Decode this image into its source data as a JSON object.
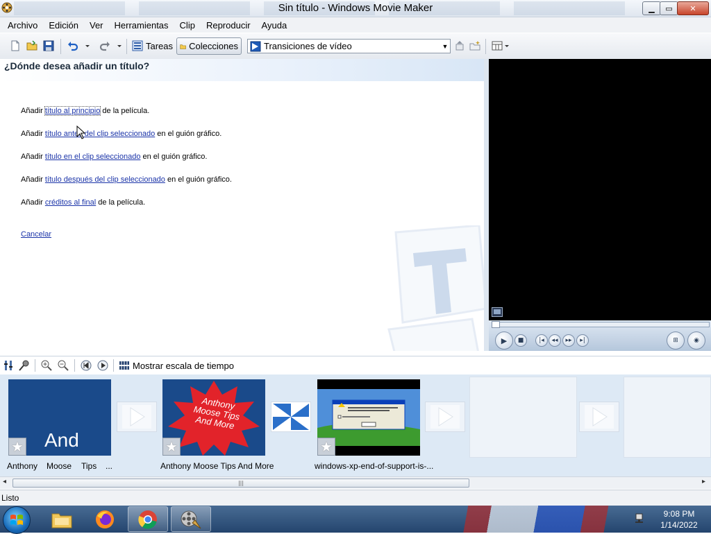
{
  "window": {
    "title": "Sin título - Windows Movie Maker",
    "min_glyph": "▁",
    "max_glyph": "▭",
    "close_glyph": "✕"
  },
  "menu": [
    "Archivo",
    "Edición",
    "Ver",
    "Herramientas",
    "Clip",
    "Reproducir",
    "Ayuda"
  ],
  "toolbar": {
    "tasks_label": "Tareas",
    "collections_label": "Colecciones",
    "collection_select_value": "Transiciones de vídeo",
    "icons": [
      "new-project-icon",
      "open-project-icon",
      "save-project-icon",
      "undo-icon",
      "redo-icon",
      "tasks-icon",
      "collections-folder-icon",
      "collection-up-icon",
      "new-collection-icon",
      "views-icon"
    ]
  },
  "task_pane": {
    "heading": "¿Dónde desea añadir un título?",
    "options": [
      {
        "pre": "Añadir ",
        "link": "título al principio",
        "post": " de la película."
      },
      {
        "pre": "Añadir ",
        "link": "título antes del clip seleccionado",
        "post": " en el guión gráfico."
      },
      {
        "pre": "Añadir ",
        "link": "título en el clip seleccionado",
        "post": " en el guión gráfico."
      },
      {
        "pre": "Añadir ",
        "link": "título después del clip seleccionado",
        "post": " en el guión gráfico."
      },
      {
        "pre": "Añadir ",
        "link": "créditos al final",
        "post": " de la película."
      }
    ],
    "cancel": "Cancelar"
  },
  "storyboard": {
    "show_timeline_label": "Mostrar escala de tiempo",
    "clips": [
      {
        "label_parts": [
          "Anthony",
          "Moose",
          "Tips",
          "..."
        ],
        "thumb_text": "And"
      },
      {
        "label": "Anthony Moose Tips And More",
        "thumb_text": "Anthony Moose Tips And More"
      },
      {
        "label": "windows-xp-end-of-support-is-..."
      }
    ],
    "star_glyph": "★"
  },
  "scrollbar": {
    "left_arrow": "◂",
    "right_arrow": "▸",
    "grip": "|||"
  },
  "status": {
    "text": "Listo"
  },
  "taskbar": {
    "apps": [
      "file-explorer-icon",
      "firefox-icon",
      "chrome-icon",
      "movie-maker-icon"
    ],
    "time": "9:08 PM",
    "date": "1/14/2022"
  },
  "colors": {
    "link": "#1a33a8",
    "clip_blue": "#1a4a8a",
    "starburst_red": "#e2232a",
    "preview_bg": "#000000"
  }
}
